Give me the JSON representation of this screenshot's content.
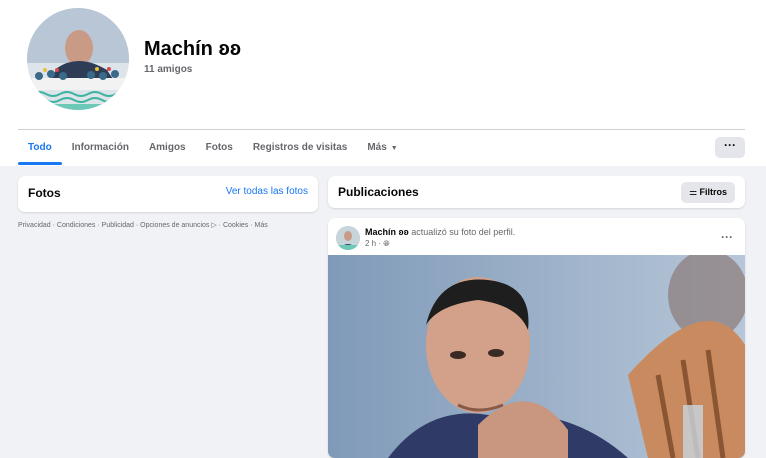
{
  "profile": {
    "name": "Machín ʚʚ",
    "friends": "11 amigos"
  },
  "tabs": [
    {
      "label": "Todo",
      "active": true
    },
    {
      "label": "Información"
    },
    {
      "label": "Amigos"
    },
    {
      "label": "Fotos"
    },
    {
      "label": "Registros de visitas"
    },
    {
      "label": "Más"
    }
  ],
  "more_button": "···",
  "fotos": {
    "title": "Fotos",
    "link": "Ver todas las fotos"
  },
  "footer": "Privacidad · Condiciones · Publicidad · Opciones de anuncios ▷ · Cookies · Más",
  "publicaciones": {
    "title": "Publicaciones",
    "filter": "Filtros"
  },
  "post": {
    "author": "Machín ʚʚ",
    "action": "actualizó su foto del perfil.",
    "time": "2 h",
    "privacy_icon": "globe-icon",
    "menu": "···"
  },
  "colors": {
    "accent": "#1877f2",
    "background": "#f0f2f5",
    "secondary_text": "#65676b"
  }
}
